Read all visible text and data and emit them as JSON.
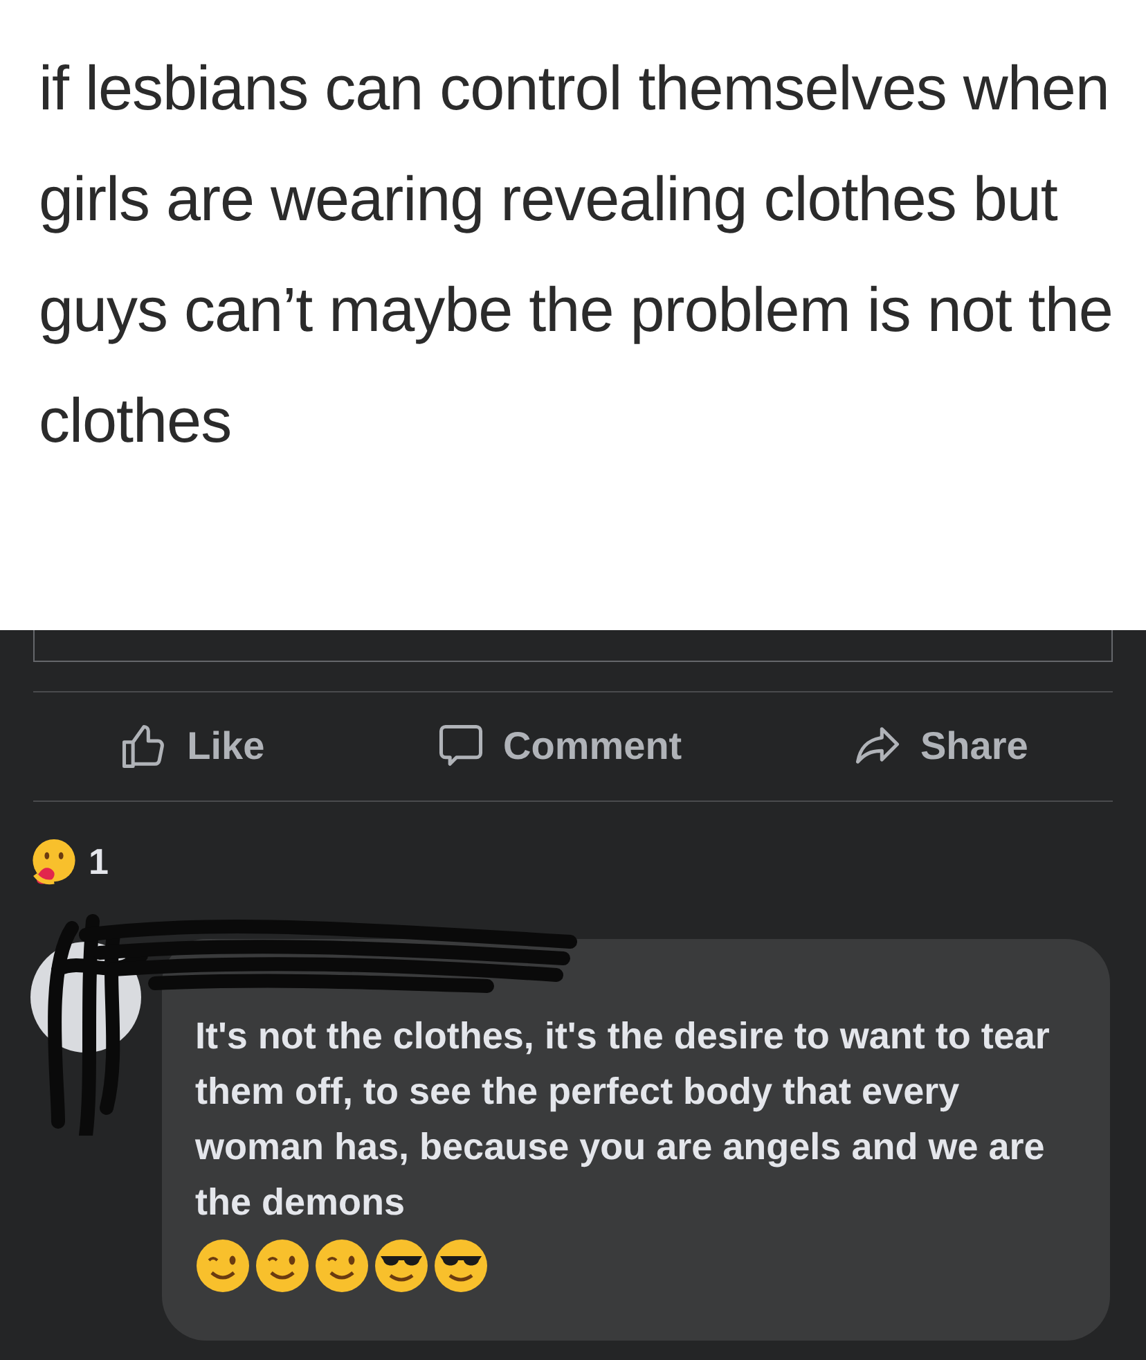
{
  "post": {
    "text": "if lesbians can control themselves when girls are wearing revealing clothes but guys can’t maybe the problem is not the clothes"
  },
  "actions": [
    {
      "kind": "like",
      "label": "Like"
    },
    {
      "kind": "comment",
      "label": "Comment"
    },
    {
      "kind": "share",
      "label": "Share"
    }
  ],
  "reactions": {
    "kind": "care",
    "count": "1"
  },
  "comment": {
    "text": "It's not the clothes, it's the desire to want to tear them off, to see the perfect body that every woman has, because you are angels and we are the demons",
    "emojis": [
      {
        "kind": "wink"
      },
      {
        "kind": "wink"
      },
      {
        "kind": "wink"
      },
      {
        "kind": "sunglasses"
      },
      {
        "kind": "sunglasses"
      }
    ]
  }
}
